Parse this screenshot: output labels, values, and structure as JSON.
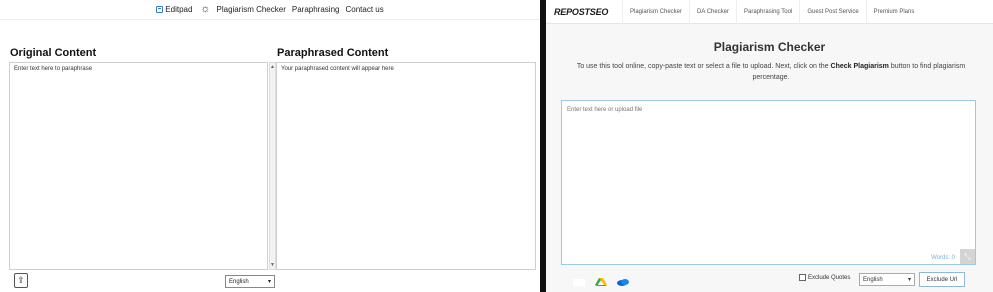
{
  "left": {
    "brand": "Editpad",
    "nav": [
      "Plagiarism Checker",
      "Paraphrasing",
      "Contact us"
    ],
    "original_heading": "Original Content",
    "paraphrased_heading": "Paraphrased Content",
    "original_placeholder": "Enter text here to paraphrase",
    "paraphrased_placeholder": "Your paraphrased content will appear here",
    "language": "English"
  },
  "right": {
    "logo": "REPOSTSEO",
    "tabs": [
      "Plagiarism Checker",
      "DA Checker",
      "Paraphrasing Tool",
      "Guest Post Service",
      "Premium Plans"
    ],
    "title": "Plagiarism Checker",
    "desc_before": "To use this tool online, copy-paste text or select a file to upload. Next, click on the ",
    "desc_bold": "Check Plagiarism",
    "desc_after": " button to find plagiarism percentage.",
    "textarea_placeholder": "Enter text here or upload file",
    "words_label": "Words: 0",
    "exclude_quotes": "Exclude Quotes",
    "language": "English",
    "exclude_url": "Exclude Url"
  },
  "colors": {
    "accent_blue": "#3a7bd5",
    "textarea_border": "#9cc7e6",
    "words_color": "#79b4d8"
  }
}
